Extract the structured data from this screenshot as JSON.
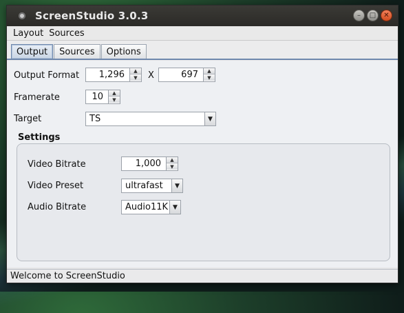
{
  "window": {
    "title": "ScreenStudio 3.0.3"
  },
  "menubar": {
    "items": [
      "Layout",
      "Sources"
    ]
  },
  "tabs": [
    "Output",
    "Sources",
    "Options"
  ],
  "output": {
    "format_label": "Output Format",
    "width_value": "1,296",
    "separator": "X",
    "height_value": "697",
    "framerate_label": "Framerate",
    "framerate_value": "10",
    "target_label": "Target",
    "target_value": "TS"
  },
  "settings": {
    "title": "Settings",
    "video_bitrate_label": "Video Bitrate",
    "video_bitrate_value": "1,000",
    "video_preset_label": "Video Preset",
    "video_preset_value": "ultrafast",
    "audio_bitrate_label": "Audio Bitrate",
    "audio_bitrate_value": "Audio11K"
  },
  "status": {
    "text": "Welcome to ScreenStudio"
  },
  "colors": {
    "accent": "#6f88ad",
    "close_button": "#e6612f",
    "window_bg": "#e7e7e8"
  }
}
